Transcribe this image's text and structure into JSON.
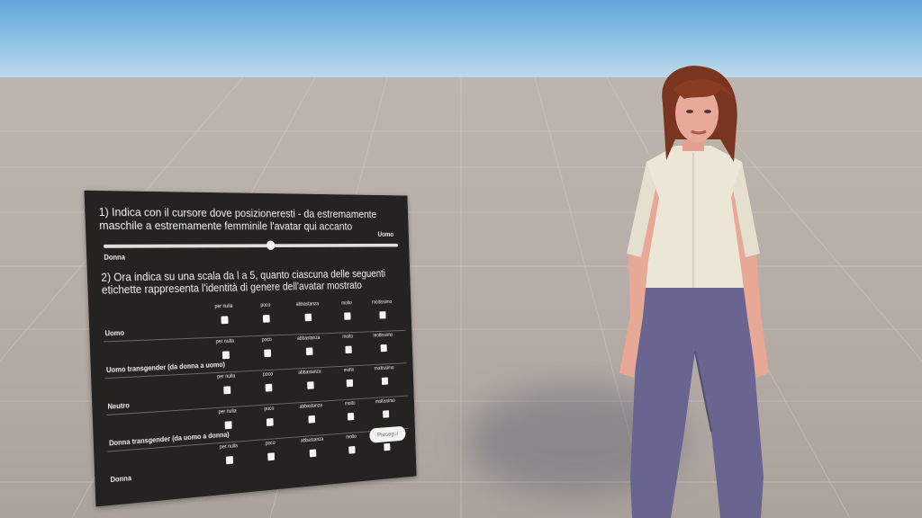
{
  "question1": {
    "text": "1) Indica con il cursore dove posizioneresti - da estremamente maschile a estremamente femminile l'avatar qui accanto",
    "slider_min_label": "Donna",
    "slider_max_label": "Uomo",
    "slider_value": 0.54
  },
  "question2": {
    "text": "2) Ora indica su una scala da l a 5, quanto ciascuna delle seguenti etichette rappresenta l'identità di genere dell'avatar mostrato",
    "options": [
      "per nulla",
      "poco",
      "abbastanza",
      "molto",
      "moltissimo"
    ],
    "rows": [
      {
        "label": "Uomo"
      },
      {
        "label": "Uomo transgender (da donna a uomo)"
      },
      {
        "label": "Neutro"
      },
      {
        "label": "Donna transgender (da uomo a donna)"
      },
      {
        "label": "Donna"
      }
    ]
  },
  "next_button": "Prosegui",
  "colors": {
    "panel": "#242322",
    "text": "#f1f1f1",
    "sky": "#5fa6dc",
    "ground": "#b7aea8"
  }
}
